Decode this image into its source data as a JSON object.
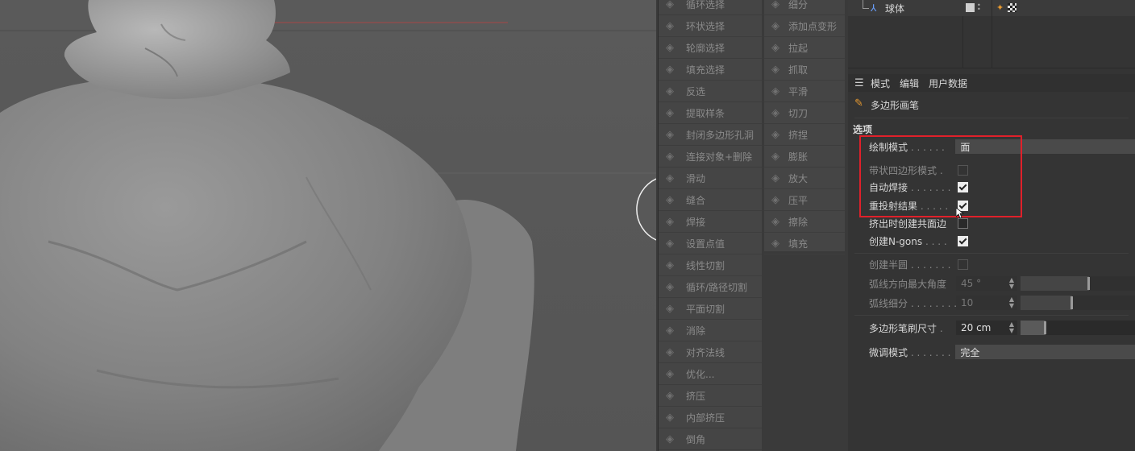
{
  "viewport": {
    "overlay_text": "",
    "grid_line_color": "#c84040"
  },
  "menu_col1": [
    {
      "icon": "loop-select-icon",
      "label": "循环选择"
    },
    {
      "icon": "ring-select-icon",
      "label": "环状选择"
    },
    {
      "icon": "outline-select-icon",
      "label": "轮廓选择"
    },
    {
      "icon": "fill-select-icon",
      "label": "填充选择"
    },
    {
      "icon": "invert-select-icon",
      "label": "反选"
    },
    {
      "icon": "extract-strip-icon",
      "label": "提取样条"
    },
    {
      "icon": "close-hole-icon",
      "label": "封闭多边形孔洞"
    },
    {
      "icon": "connect-delete-icon",
      "label": "连接对象+删除"
    },
    {
      "icon": "slide-icon",
      "label": "滑动"
    },
    {
      "icon": "stitch-icon",
      "label": "缝合"
    },
    {
      "icon": "weld-icon",
      "label": "焊接"
    },
    {
      "icon": "set-point-value-icon",
      "label": "设置点值"
    },
    {
      "icon": "line-cut-icon",
      "label": "线性切割"
    },
    {
      "icon": "loop-path-cut-icon",
      "label": "循环/路径切割"
    },
    {
      "icon": "plane-cut-icon",
      "label": "平面切割"
    },
    {
      "icon": "dissolve-icon",
      "label": "消除"
    },
    {
      "icon": "align-normals-icon",
      "label": "对齐法线"
    },
    {
      "icon": "optimize-icon",
      "label": "优化..."
    },
    {
      "icon": "extrude-icon",
      "label": "挤压"
    },
    {
      "icon": "inner-extrude-icon",
      "label": "内部挤压"
    },
    {
      "icon": "bevel-icon",
      "label": "倒角"
    }
  ],
  "menu_col2": [
    {
      "icon": "subdivide-icon",
      "label": "细分"
    },
    {
      "icon": "add-point-icon",
      "label": "添加点变形"
    },
    {
      "icon": "pull-icon",
      "label": "拉起"
    },
    {
      "icon": "grab-icon",
      "label": "抓取"
    },
    {
      "icon": "smooth-icon",
      "label": "平滑"
    },
    {
      "icon": "knife-icon",
      "label": "切刀"
    },
    {
      "icon": "pinch-icon",
      "label": "挤捏"
    },
    {
      "icon": "inflate-icon",
      "label": "膨胀"
    },
    {
      "icon": "magnify-icon",
      "label": "放大"
    },
    {
      "icon": "flatten-icon",
      "label": "压平"
    },
    {
      "icon": "erase-icon",
      "label": "擦除"
    },
    {
      "icon": "fill-brush-icon",
      "label": "填充"
    }
  ],
  "object": {
    "name": "球体"
  },
  "tabs": [
    "模式",
    "编辑",
    "用户数据"
  ],
  "panel_title": "多边形画笔",
  "section_label": "选项",
  "options": {
    "draw_mode": {
      "label": "绘制模式",
      "dots": " . . . . . .",
      "value": "面"
    },
    "quad_strip": {
      "label": "带状四边形模式",
      "dots": " .",
      "checked": false
    },
    "auto_weld": {
      "label": "自动焊接",
      "dots": " . . . . . . .",
      "checked": true
    },
    "reproject": {
      "label": "重投射结果",
      "dots": " . . . . .",
      "checked": true
    },
    "extrude_shared": {
      "label": "挤出时创建共面边",
      "dots": "",
      "checked": false
    },
    "create_ngons": {
      "label": "创建N-gons",
      "dots": " . . . .",
      "checked": true
    },
    "create_semicircle": {
      "label": "创建半圆",
      "dots": " . . . . . . .",
      "checked": false
    },
    "arc_max_angle": {
      "label": "弧线方向最大角度",
      "dots": "",
      "value": "45 °",
      "fraction": 0.6
    },
    "arc_subdiv": {
      "label": "弧线细分",
      "dots": " . . . . . . . .",
      "value": "10",
      "fraction": 0.45
    },
    "brush_size": {
      "label": "多边形笔刷尺寸",
      "dots": " .",
      "value": "20 cm",
      "fraction": 0.22
    },
    "tweak_mode": {
      "label": "微调模式",
      "dots": " . . . . . . .",
      "value": "完全"
    }
  }
}
